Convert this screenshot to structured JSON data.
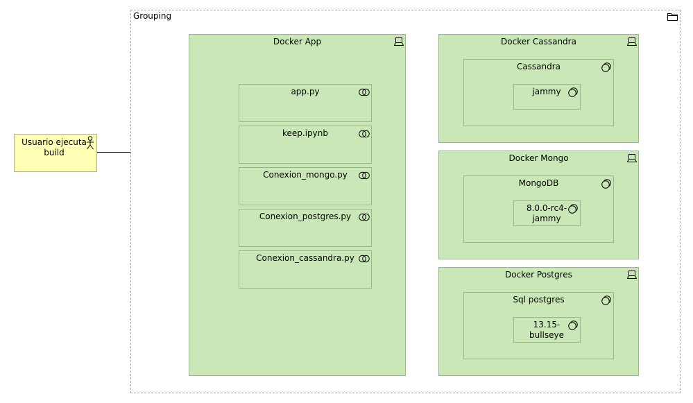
{
  "grouping": {
    "label": "Grouping"
  },
  "actor": {
    "label": "Usuario ejecuta build"
  },
  "app": {
    "label": "Docker App",
    "files": [
      {
        "label": "app.py"
      },
      {
        "label": "keep.ipynb"
      },
      {
        "label": "Conexion_mongo.py"
      },
      {
        "label": "Conexion_postgres.py"
      },
      {
        "label": "Conexion_cassandra.py"
      }
    ]
  },
  "cassandra": {
    "label": "Docker Cassandra",
    "service": "Cassandra",
    "version": "jammy"
  },
  "mongo": {
    "label": "Docker Mongo",
    "service": "MongoDB",
    "version": "8.0.0-rc4-jammy"
  },
  "postgres": {
    "label": "Docker Postgres",
    "service": "Sql postgres",
    "version": "13.15-bullseye"
  },
  "icons": {
    "grouping": "folder-icon",
    "actor": "actor-icon",
    "node": "device-icon",
    "interface": "interface-icon",
    "service": "system-software-icon"
  },
  "colors": {
    "node_fill": "#c9e7b7",
    "node_border": "#9cb58f",
    "actor_fill": "#ffffb5",
    "group_border": "#a6a6a6"
  }
}
